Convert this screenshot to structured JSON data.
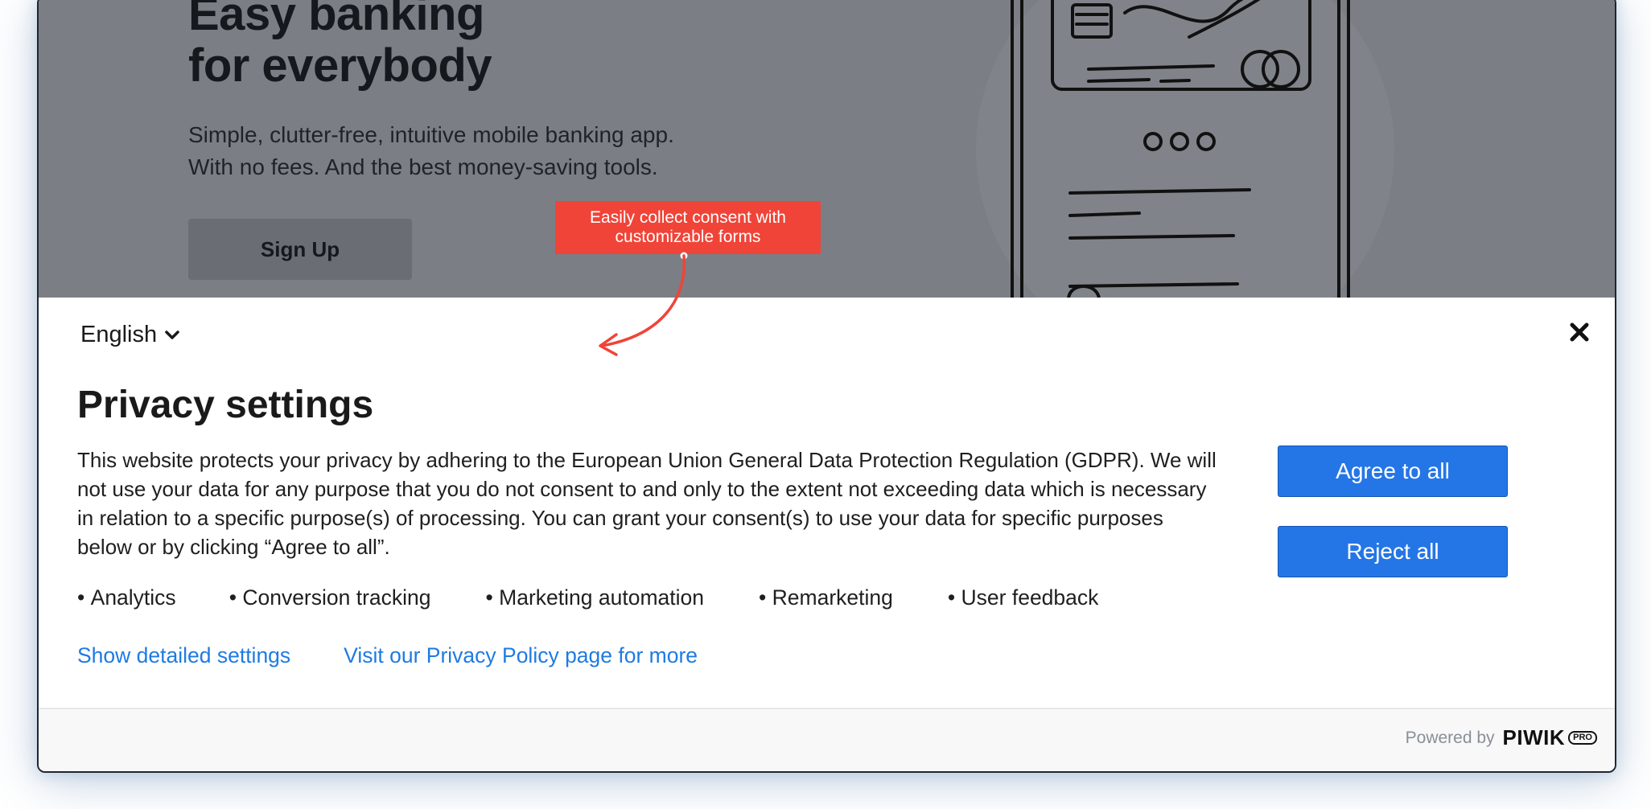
{
  "hero": {
    "title_line1": "Easy banking",
    "title_line2": "for everybody",
    "subtitle_line1": "Simple, clutter-free, intuitive mobile banking app.",
    "subtitle_line2": "With no fees. And the best money-saving tools.",
    "signup_label": "Sign Up"
  },
  "callout": {
    "line1": "Easily collect consent with",
    "line2": "customizable forms"
  },
  "banner": {
    "language": "English",
    "title": "Privacy settings",
    "text": "This website protects your privacy by adhering to the European Union General Data Protection Regulation (GDPR). We will not use your data for any purpose that you do not consent to and only to the extent not exceeding data which is necessary in relation to a specific purpose(s) of processing. You can grant your consent(s) to use your data for specific purposes below or by clicking “Agree to all”.",
    "purposes": [
      "Analytics",
      "Conversion tracking",
      "Marketing automation",
      "Remarketing",
      "User feedback"
    ],
    "links": {
      "detailed": "Show detailed settings",
      "policy": "Visit our Privacy Policy page for more"
    },
    "buttons": {
      "agree": "Agree to all",
      "reject": "Reject all"
    }
  },
  "footer": {
    "powered_by": "Powered by",
    "logo_word": "PIWIK",
    "logo_badge": "PRO"
  },
  "colors": {
    "accent_blue": "#2476e6",
    "link_blue": "#1e7be2",
    "callout_red": "#f04438",
    "overlay_gray": "#7b7e84"
  },
  "icons": [
    "chevron-down-icon",
    "close-icon",
    "phone-illustration"
  ]
}
